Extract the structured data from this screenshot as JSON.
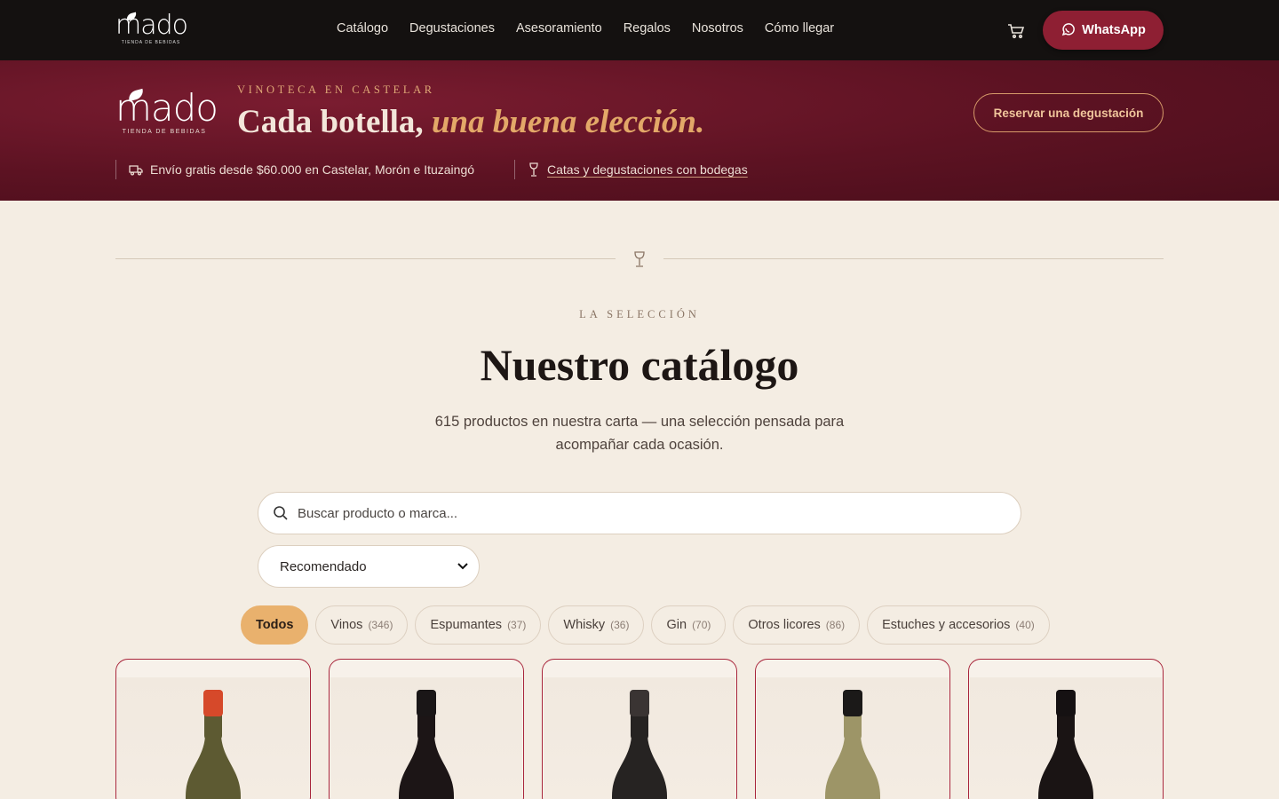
{
  "nav": {
    "logo_word": "mado",
    "logo_sub": "TIENDA DE BEBIDAS",
    "links": [
      "Catálogo",
      "Degustaciones",
      "Asesoramiento",
      "Regalos",
      "Nosotros",
      "Cómo llegar"
    ],
    "cart_icon": "cart-icon",
    "whatsapp_label": "WhatsApp"
  },
  "banner": {
    "logo_word": "mado",
    "logo_sub": "TIENDA DE BEBIDAS",
    "kicker": "VINOTECA EN CASTELAR",
    "headline_main": "Cada botella, ",
    "headline_accent": "una buena elección.",
    "reserve_label": "Reservar una degustación",
    "shipping_text": "Envío gratis desde $60.000 en Castelar, Morón e Ituzaingó",
    "tastings_link": "Catas y degustaciones con bodegas"
  },
  "catalog": {
    "eyebrow": "LA SELECCIÓN",
    "title": "Nuestro catálogo",
    "lede": "615 productos en nuestra carta — una selección pensada para acompañar cada ocasión.",
    "search_placeholder": "Buscar producto o marca...",
    "sort_selected": "Recomendado",
    "filters": [
      {
        "label": "Todos",
        "count": ""
      },
      {
        "label": "Vinos",
        "count": "(346)"
      },
      {
        "label": "Espumantes",
        "count": "(37)"
      },
      {
        "label": "Whisky",
        "count": "(36)"
      },
      {
        "label": "Gin",
        "count": "(70)"
      },
      {
        "label": "Otros licores",
        "count": "(86)"
      },
      {
        "label": "Estuches y accesorios",
        "count": "(40)"
      }
    ]
  },
  "colors": {
    "nav_bg": "#141110",
    "banner_bg": "#5c1222",
    "accent_gold": "#e9b16d",
    "whatsapp_btn": "#8e1f33",
    "page_bg": "#f4ede3"
  },
  "products": [
    {
      "bottle_color": "#5d5a32",
      "cap_color": "#d6492a",
      "bottle_icon": "wine-bottle-icon"
    },
    {
      "bottle_color": "#1c1516",
      "cap_color": "#1a1617",
      "bottle_icon": "wine-bottle-icon"
    },
    {
      "bottle_color": "#262322",
      "cap_color": "#3a3433",
      "bottle_icon": "wine-bottle-icon"
    },
    {
      "bottle_color": "#9d9567",
      "cap_color": "#1b1918",
      "bottle_icon": "wine-bottle-icon"
    },
    {
      "bottle_color": "#1a1414",
      "cap_color": "#151112",
      "bottle_icon": "wine-bottle-icon"
    }
  ]
}
